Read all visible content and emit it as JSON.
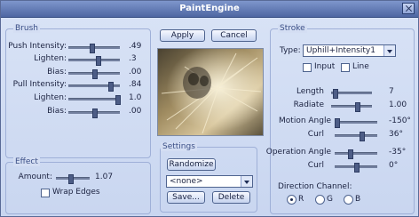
{
  "window": {
    "title": "PaintEngine"
  },
  "brush": {
    "label": "Brush",
    "rows": [
      {
        "label": "Push Intensity:",
        "value": ".49"
      },
      {
        "label": "Lighten:",
        "value": ".3"
      },
      {
        "label": "Bias:",
        "value": ".00"
      },
      {
        "label": "Pull Intensity:",
        "value": ".84"
      },
      {
        "label": "Lighten:",
        "value": "1.0"
      },
      {
        "label": "Bias:",
        "value": ".00"
      }
    ]
  },
  "effect": {
    "label": "Effect",
    "amount_label": "Amount:",
    "amount_value": "1.07",
    "wrap_edges_label": "Wrap Edges"
  },
  "buttons": {
    "apply": "Apply",
    "cancel": "Cancel",
    "randomize": "Randomize",
    "save": "Save...",
    "delete": "Delete"
  },
  "settings": {
    "label": "Settings",
    "current": "<none>"
  },
  "stroke": {
    "label": "Stroke",
    "type_label": "Type:",
    "type_value": "Uphill+Intensity1",
    "input_label": "Input",
    "line_label": "Line",
    "rows": [
      {
        "label": "Length",
        "value": "7"
      },
      {
        "label": "Radiate",
        "value": "1.00"
      },
      {
        "label": "Motion Angle",
        "value": "-150°"
      },
      {
        "label": "Curl",
        "value": "36°"
      },
      {
        "label": "Operation Angle",
        "value": "-35°"
      },
      {
        "label": "Curl",
        "value": "0°"
      }
    ],
    "direction_label": "Direction Channel:",
    "channels": [
      "R",
      "G",
      "B"
    ]
  }
}
